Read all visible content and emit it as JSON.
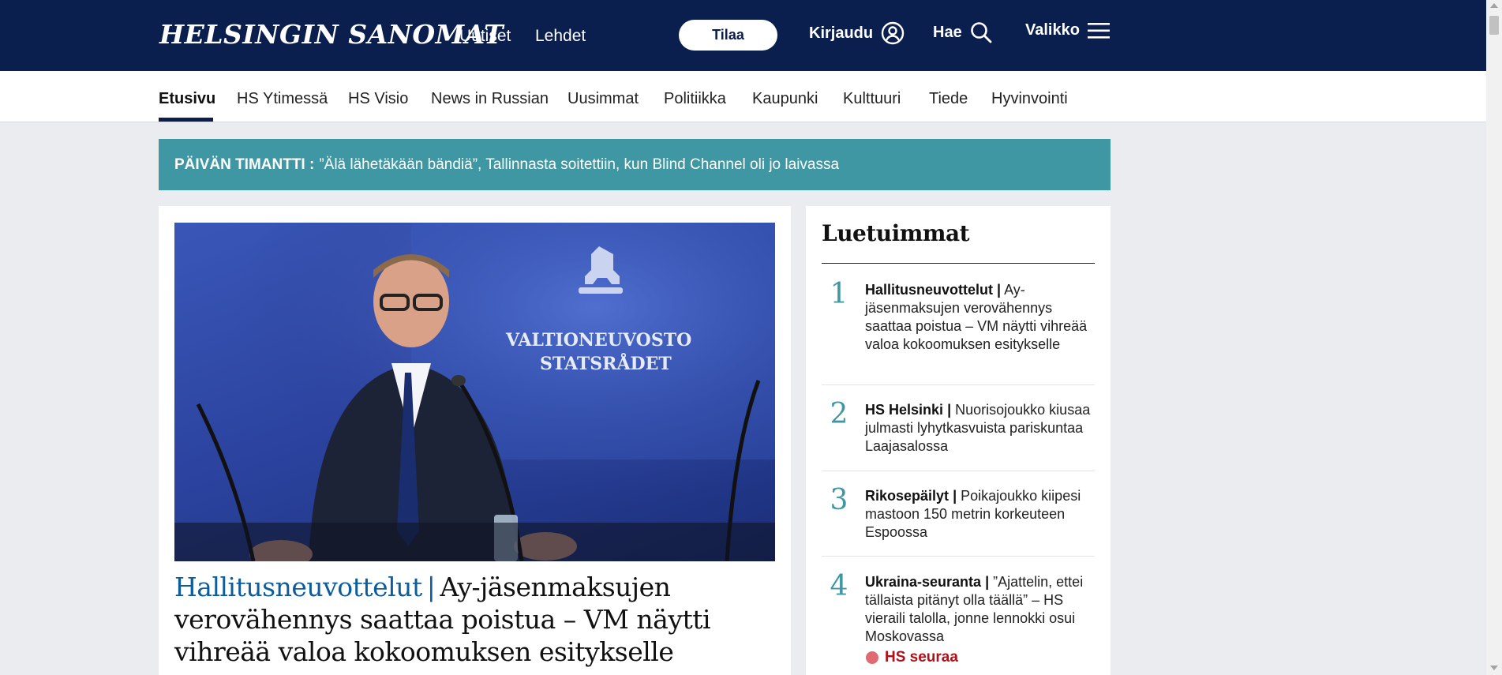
{
  "header": {
    "logo": "HELSINGIN SANOMAT",
    "links": [
      "Uutiset",
      "Lehdet"
    ],
    "subscribe_label": "Tilaa",
    "login_label": "Kirjaudu",
    "search_label": "Hae",
    "menu_label": "Valikko",
    "login_icon": "user-circle-icon",
    "search_icon": "search-icon",
    "menu_icon": "hamburger-icon"
  },
  "nav": {
    "items": [
      "Etusivu",
      "HS Ytimessä",
      "HS Visio",
      "News in Russian",
      "Uusimmat",
      "Politiikka",
      "Kaupunki",
      "Kulttuuri",
      "Tiede",
      "Hyvinvointi"
    ],
    "active": "Etusivu"
  },
  "banner": {
    "kicker": "PÄIVÄN TIMANTTI :",
    "text": "”Älä lähetäkään bändiä”, Tallinnasta soitettiin, kun Blind Channel oli jo laivassa"
  },
  "main_article": {
    "image_text_1": "VALTIONEUVOSTO",
    "image_text_2": "STATSRÅDET",
    "kicker": "Hallitusneuvottelut",
    "separator": "|",
    "title": "Ay-jäsenmaksujen verovähennys saattaa poistua – VM näytti vihreää valoa kokoomuksen esitykselle"
  },
  "most_read": {
    "title": "Luetuimmat",
    "items": [
      {
        "num": "1",
        "kicker": "Hallitusneuvottelut",
        "sep": "|",
        "text": "Ay-jäsenmaksujen verovähennys saattaa poistua – VM näytti vihreää valoa kokoomuksen esitykselle"
      },
      {
        "num": "2",
        "kicker": "HS Helsinki",
        "sep": "|",
        "text": "Nuorisojoukko kiusaa julmasti lyhytkasvuista pariskuntaa Laajasalossa"
      },
      {
        "num": "3",
        "kicker": "Rikosepäilyt",
        "sep": "|",
        "text": "Poikajoukko kiipesi mastoon 150 metrin korkeuteen Espoossa"
      },
      {
        "num": "4",
        "kicker": "Ukraina-seuranta",
        "sep": "|",
        "text": "”Ajattelin, ettei tällaista pitänyt olla täällä” – HS vieraili talolla, jonne lennokki osui Moskovassa"
      }
    ],
    "follow_label": "HS seuraa"
  },
  "colors": {
    "header_bg": "#0b1f4f",
    "banner_bg": "#3f97a3",
    "kicker_blue": "#0d5c9c",
    "follow_red": "#b0101a"
  }
}
